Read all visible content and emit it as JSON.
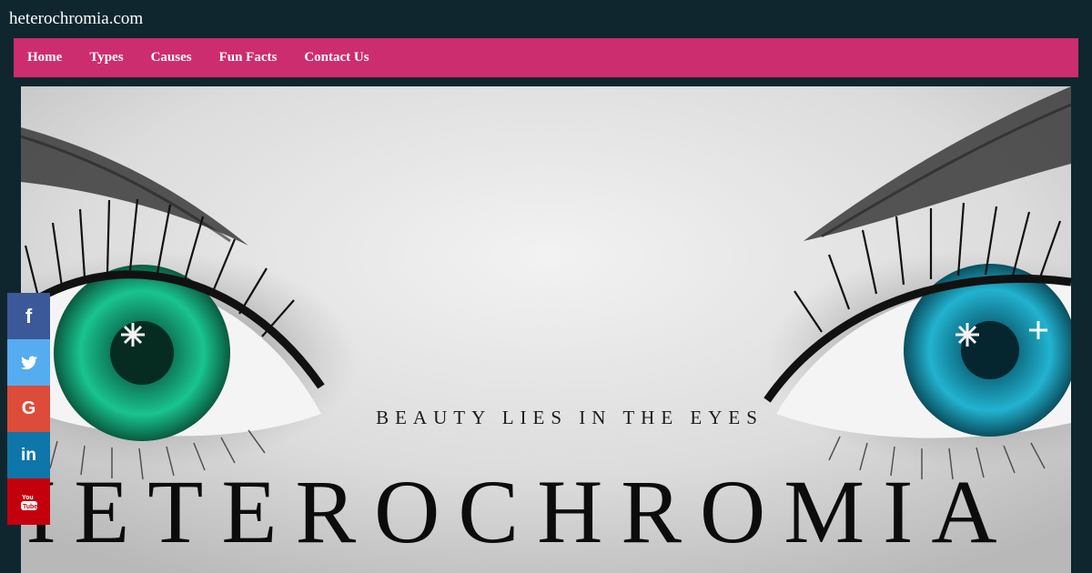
{
  "site": {
    "title": "heterochromia.com"
  },
  "nav": {
    "items": [
      {
        "label": "Home"
      },
      {
        "label": "Types"
      },
      {
        "label": "Causes"
      },
      {
        "label": "Fun Facts"
      },
      {
        "label": "Contact Us"
      }
    ]
  },
  "hero": {
    "tagline": "BEAUTY LIES IN THE EYES",
    "title": "HETEROCHROMIA"
  },
  "social": {
    "buttons": [
      {
        "icon": "facebook-icon",
        "color": "#3b5998",
        "glyph": "f"
      },
      {
        "icon": "twitter-icon",
        "color": "#55acee",
        "glyph": ""
      },
      {
        "icon": "google-icon",
        "color": "#dd4b39",
        "glyph": "G"
      },
      {
        "icon": "linkedin-icon",
        "color": "#0e76a8",
        "glyph": "in"
      },
      {
        "icon": "youtube-icon",
        "color": "#c4000d",
        "glyph": ""
      }
    ]
  },
  "colors": {
    "background": "#10262f",
    "nav": "#cc2d6e",
    "left_iris": "#14b88a",
    "right_iris": "#1a9fb8"
  }
}
